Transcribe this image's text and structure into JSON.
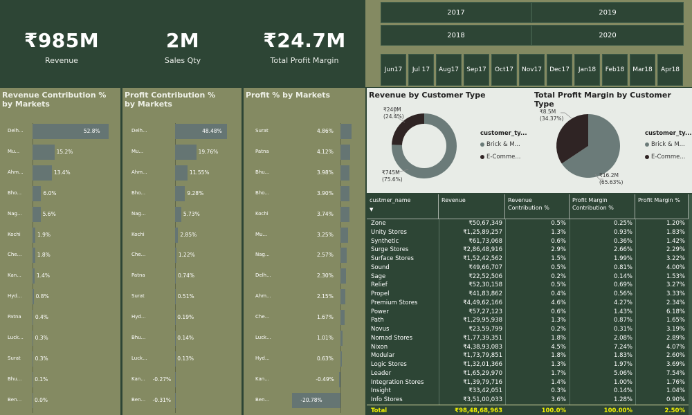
{
  "kpis": [
    {
      "value": "₹985M",
      "label": "Revenue"
    },
    {
      "value": "2M",
      "label": "Sales Qty"
    },
    {
      "value": "₹24.7M",
      "label": "Total Profit Margin"
    }
  ],
  "years": [
    "2017",
    "2019",
    "2018",
    "2020"
  ],
  "months": [
    {
      "m": "Jun",
      "y": "17"
    },
    {
      "m": "Jul 17",
      "y": ""
    },
    {
      "m": "Aug",
      "y": "17"
    },
    {
      "m": "Sep",
      "y": "17"
    },
    {
      "m": "Oct",
      "y": "17"
    },
    {
      "m": "Nov",
      "y": "17"
    },
    {
      "m": "Dec",
      "y": "17"
    },
    {
      "m": "Jan",
      "y": "18"
    },
    {
      "m": "Feb",
      "y": "18"
    },
    {
      "m": "Mar",
      "y": "18"
    },
    {
      "m": "Apr",
      "y": "18"
    }
  ],
  "rev_contrib": {
    "title": "Revenue Contribution % by Markets",
    "rows": [
      {
        "market": "Delh...",
        "value": 52.8,
        "label": "52.8%"
      },
      {
        "market": "Mu...",
        "value": 15.2,
        "label": "15.2%"
      },
      {
        "market": "Ahm...",
        "value": 13.4,
        "label": "13.4%"
      },
      {
        "market": "Bho...",
        "value": 6.0,
        "label": "6.0%"
      },
      {
        "market": "Nag...",
        "value": 5.6,
        "label": "5.6%"
      },
      {
        "market": "Kochi",
        "value": 1.9,
        "label": "1.9%"
      },
      {
        "market": "Che...",
        "value": 1.8,
        "label": "1.8%"
      },
      {
        "market": "Kan...",
        "value": 1.4,
        "label": "1.4%"
      },
      {
        "market": "Hyd...",
        "value": 0.8,
        "label": "0.8%"
      },
      {
        "market": "Patna",
        "value": 0.4,
        "label": "0.4%"
      },
      {
        "market": "Luck...",
        "value": 0.3,
        "label": "0.3%"
      },
      {
        "market": "Surat",
        "value": 0.3,
        "label": "0.3%"
      },
      {
        "market": "Bhu...",
        "value": 0.1,
        "label": "0.1%"
      },
      {
        "market": "Ben...",
        "value": 0.0,
        "label": "0.0%"
      }
    ]
  },
  "profit_contrib": {
    "title": "Profit Contribution % by Markets",
    "rows": [
      {
        "market": "Delh...",
        "value": 48.48,
        "label": "48.48%"
      },
      {
        "market": "Mu...",
        "value": 19.76,
        "label": "19.76%"
      },
      {
        "market": "Ahm...",
        "value": 11.55,
        "label": "11.55%"
      },
      {
        "market": "Bho...",
        "value": 9.28,
        "label": "9.28%"
      },
      {
        "market": "Nag...",
        "value": 5.73,
        "label": "5.73%"
      },
      {
        "market": "Kochi",
        "value": 2.85,
        "label": "2.85%"
      },
      {
        "market": "Che...",
        "value": 1.22,
        "label": "1.22%"
      },
      {
        "market": "Patna",
        "value": 0.74,
        "label": "0.74%"
      },
      {
        "market": "Surat",
        "value": 0.51,
        "label": "0.51%"
      },
      {
        "market": "Hyd...",
        "value": 0.19,
        "label": "0.19%"
      },
      {
        "market": "Bhu...",
        "value": 0.14,
        "label": "0.14%"
      },
      {
        "market": "Luck...",
        "value": 0.13,
        "label": "0.13%"
      },
      {
        "market": "Kan...",
        "value": -0.27,
        "label": "-0.27%"
      },
      {
        "market": "Ben...",
        "value": -0.31,
        "label": "-0.31%"
      }
    ]
  },
  "profit_pct": {
    "title": "Profit % by Markets",
    "rows": [
      {
        "market": "Surat",
        "value": 4.86,
        "label": "4.86%"
      },
      {
        "market": "Patna",
        "value": 4.12,
        "label": "4.12%"
      },
      {
        "market": "Bhu...",
        "value": 3.98,
        "label": "3.98%"
      },
      {
        "market": "Bho...",
        "value": 3.9,
        "label": "3.90%"
      },
      {
        "market": "Kochi",
        "value": 3.74,
        "label": "3.74%"
      },
      {
        "market": "Mu...",
        "value": 3.25,
        "label": "3.25%"
      },
      {
        "market": "Nag...",
        "value": 2.57,
        "label": "2.57%"
      },
      {
        "market": "Delh...",
        "value": 2.3,
        "label": "2.30%"
      },
      {
        "market": "Ahm...",
        "value": 2.15,
        "label": "2.15%"
      },
      {
        "market": "Che...",
        "value": 1.67,
        "label": "1.67%"
      },
      {
        "market": "Luck...",
        "value": 1.01,
        "label": "1.01%"
      },
      {
        "market": "Hyd...",
        "value": 0.63,
        "label": "0.63%"
      },
      {
        "market": "Kan...",
        "value": -0.49,
        "label": "-0.49%"
      },
      {
        "market": "Ben...",
        "value": -20.78,
        "label": "-20.78%"
      }
    ]
  },
  "donuts": {
    "revenue": {
      "title": "Revenue by Customer Type",
      "top_label": "₹240M",
      "top_pct": "(24.4%)",
      "bottom_label": "₹745M",
      "bottom_pct": "(75.6%)",
      "slices": [
        75.6,
        24.4
      ]
    },
    "profit": {
      "title": "Total Profit Margin by Customer Type",
      "top_label": "₹8.5M",
      "top_pct": "(34.37%)",
      "bottom_label": "₹16.2M",
      "bottom_pct": "(65.63%)",
      "slices": [
        65.63,
        34.37
      ]
    },
    "legend_title": "customer_ty...",
    "legend": [
      {
        "name": "Brick & M...",
        "color": "#6b7b79"
      },
      {
        "name": "E-Comme...",
        "color": "#2f2424"
      }
    ]
  },
  "table": {
    "headers": [
      "custmer_name",
      "Revenue",
      "Revenue Contribution %",
      "Profit Margin Contribution %",
      "Profit Margin %"
    ],
    "rows": [
      [
        "Zone",
        "₹50,67,349",
        "0.5%",
        "0.25%",
        "1.20%"
      ],
      [
        "Unity Stores",
        "₹1,25,89,257",
        "1.3%",
        "0.93%",
        "1.83%"
      ],
      [
        "Synthetic",
        "₹61,73,068",
        "0.6%",
        "0.36%",
        "1.42%"
      ],
      [
        "Surge Stores",
        "₹2,86,48,916",
        "2.9%",
        "2.66%",
        "2.29%"
      ],
      [
        "Surface Stores",
        "₹1,52,42,562",
        "1.5%",
        "1.99%",
        "3.22%"
      ],
      [
        "Sound",
        "₹49,66,707",
        "0.5%",
        "0.81%",
        "4.00%"
      ],
      [
        "Sage",
        "₹22,52,506",
        "0.2%",
        "0.14%",
        "1.53%"
      ],
      [
        "Relief",
        "₹52,30,158",
        "0.5%",
        "0.69%",
        "3.27%"
      ],
      [
        "Propel",
        "₹41,83,862",
        "0.4%",
        "0.56%",
        "3.33%"
      ],
      [
        "Premium Stores",
        "₹4,49,62,166",
        "4.6%",
        "4.27%",
        "2.34%"
      ],
      [
        "Power",
        "₹57,27,123",
        "0.6%",
        "1.43%",
        "6.18%"
      ],
      [
        "Path",
        "₹1,29,95,938",
        "1.3%",
        "0.87%",
        "1.65%"
      ],
      [
        "Novus",
        "₹23,59,799",
        "0.2%",
        "0.31%",
        "3.19%"
      ],
      [
        "Nomad Stores",
        "₹1,77,39,351",
        "1.8%",
        "2.08%",
        "2.89%"
      ],
      [
        "Nixon",
        "₹4,38,93,083",
        "4.5%",
        "7.24%",
        "4.07%"
      ],
      [
        "Modular",
        "₹1,73,79,851",
        "1.8%",
        "1.83%",
        "2.60%"
      ],
      [
        "Logic Stores",
        "₹1,32,01,366",
        "1.3%",
        "1.97%",
        "3.69%"
      ],
      [
        "Leader",
        "₹1,65,29,970",
        "1.7%",
        "5.06%",
        "7.54%"
      ],
      [
        "Integration Stores",
        "₹1,39,79,716",
        "1.4%",
        "1.00%",
        "1.76%"
      ],
      [
        "Insight",
        "₹33,42,051",
        "0.3%",
        "0.14%",
        "1.04%"
      ],
      [
        "Info Stores",
        "₹3,51,00,033",
        "3.6%",
        "1.28%",
        "0.90%"
      ]
    ],
    "total": [
      "Total",
      "₹98,48,68,963",
      "100.0%",
      "100.00%",
      "2.50%"
    ]
  },
  "chart_data": [
    {
      "type": "bar",
      "title": "Revenue Contribution % by Markets",
      "categories": [
        "Delh...",
        "Mu...",
        "Ahm...",
        "Bho...",
        "Nag...",
        "Kochi",
        "Che...",
        "Kan...",
        "Hyd...",
        "Patna",
        "Luck...",
        "Surat",
        "Bhu...",
        "Ben..."
      ],
      "values": [
        52.8,
        15.2,
        13.4,
        6.0,
        5.6,
        1.9,
        1.8,
        1.4,
        0.8,
        0.4,
        0.3,
        0.3,
        0.1,
        0.0
      ]
    },
    {
      "type": "bar",
      "title": "Profit Contribution % by Markets",
      "categories": [
        "Delh...",
        "Mu...",
        "Ahm...",
        "Bho...",
        "Nag...",
        "Kochi",
        "Che...",
        "Patna",
        "Surat",
        "Hyd...",
        "Bhu...",
        "Luck...",
        "Kan...",
        "Ben..."
      ],
      "values": [
        48.48,
        19.76,
        11.55,
        9.28,
        5.73,
        2.85,
        1.22,
        0.74,
        0.51,
        0.19,
        0.14,
        0.13,
        -0.27,
        -0.31
      ]
    },
    {
      "type": "bar",
      "title": "Profit % by Markets",
      "categories": [
        "Surat",
        "Patna",
        "Bhu...",
        "Bho...",
        "Kochi",
        "Mu...",
        "Nag...",
        "Delh...",
        "Ahm...",
        "Che...",
        "Luck...",
        "Hyd...",
        "Kan...",
        "Ben..."
      ],
      "values": [
        4.86,
        4.12,
        3.98,
        3.9,
        3.74,
        3.25,
        2.57,
        2.3,
        2.15,
        1.67,
        1.01,
        0.63,
        -0.49,
        -20.78
      ]
    },
    {
      "type": "pie",
      "title": "Revenue by Customer Type",
      "categories": [
        "Brick & M...",
        "E-Comme..."
      ],
      "values": [
        745,
        240
      ]
    },
    {
      "type": "pie",
      "title": "Total Profit Margin by Customer Type",
      "categories": [
        "Brick & M...",
        "E-Comme..."
      ],
      "values": [
        16.2,
        8.5
      ]
    }
  ]
}
